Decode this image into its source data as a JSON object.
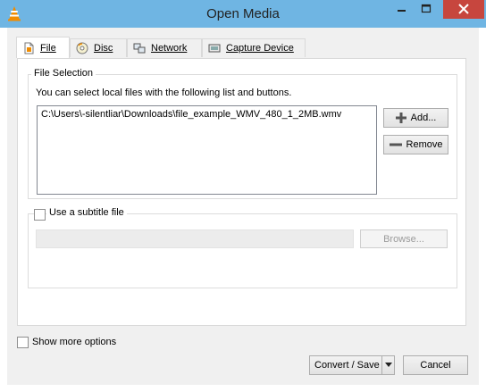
{
  "window": {
    "title": "Open Media"
  },
  "tabs": [
    {
      "label": "File",
      "accel": "F",
      "icon": "file-icon"
    },
    {
      "label": "Disc",
      "accel": "D",
      "icon": "disc-icon"
    },
    {
      "label": "Network",
      "accel": "N",
      "icon": "network-icon"
    },
    {
      "label": "Capture Device",
      "accel": "C",
      "icon": "capture-device-icon"
    }
  ],
  "file_selection": {
    "group_label": "File Selection",
    "instructions": "You can select local files with the following list and buttons.",
    "files": [
      "C:\\Users\\-silentliar\\Downloads\\file_example_WMV_480_1_2MB.wmv"
    ],
    "add_label": "Add...",
    "remove_label": "Remove"
  },
  "subtitle": {
    "checkbox_label": "Use a subtitle file",
    "checked": false,
    "path_value": "",
    "browse_label": "Browse..."
  },
  "options": {
    "show_more_label": "Show more options",
    "checked": false
  },
  "footer": {
    "convert_label": "Convert / Save",
    "cancel_label": "Cancel"
  },
  "colors": {
    "titlebar": "#6fb5e3",
    "close": "#c7463e",
    "vlc_orange": "#f08c00"
  }
}
